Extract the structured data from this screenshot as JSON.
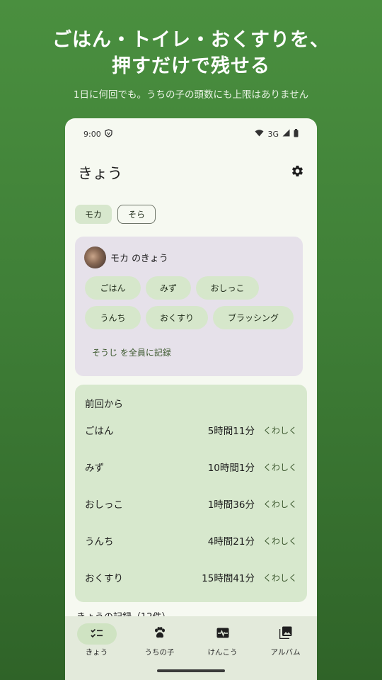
{
  "promo": {
    "title_line1": "ごはん・トイレ・おくすりを、",
    "title_line2": "押すだけで残せる",
    "subtitle": "1日に何回でも。うちの子の頭数にも上限はありません"
  },
  "status_bar": {
    "time": "9:00",
    "network": "3G"
  },
  "app_bar": {
    "title": "きょう"
  },
  "pets": [
    {
      "label": "モカ",
      "selected": true
    },
    {
      "label": "そら",
      "selected": false
    }
  ],
  "pet_card": {
    "heading": "モカ のきょう",
    "actions": [
      "ごはん",
      "みず",
      "おしっこ",
      "うんち",
      "おくすり",
      "ブラッシング"
    ],
    "sweep_link": "そうじ を全員に記録"
  },
  "since_card": {
    "title": "前回から",
    "rows": [
      {
        "label": "ごはん",
        "elapsed": "5時間11分",
        "detail": "くわしく"
      },
      {
        "label": "みず",
        "elapsed": "10時間1分",
        "detail": "くわしく"
      },
      {
        "label": "おしっこ",
        "elapsed": "1時間36分",
        "detail": "くわしく"
      },
      {
        "label": "うんち",
        "elapsed": "4時間21分",
        "detail": "くわしく"
      },
      {
        "label": "おくすり",
        "elapsed": "15時間41分",
        "detail": "くわしく"
      }
    ]
  },
  "peek_text": "きょうの記録（12件）",
  "bottom_nav": [
    {
      "label": "きょう",
      "icon": "checklist-icon",
      "active": true
    },
    {
      "label": "うちの子",
      "icon": "paw-icon",
      "active": false
    },
    {
      "label": "けんこう",
      "icon": "monitor-heart-icon",
      "active": false
    },
    {
      "label": "アルバム",
      "icon": "photo-album-icon",
      "active": false
    }
  ],
  "colors": {
    "background": "#3f7f37",
    "surface": "#f6f9f1",
    "pet_card": "#e6e1ea",
    "since_card": "#d7e8cd",
    "accent_text": "#3e5a30"
  }
}
